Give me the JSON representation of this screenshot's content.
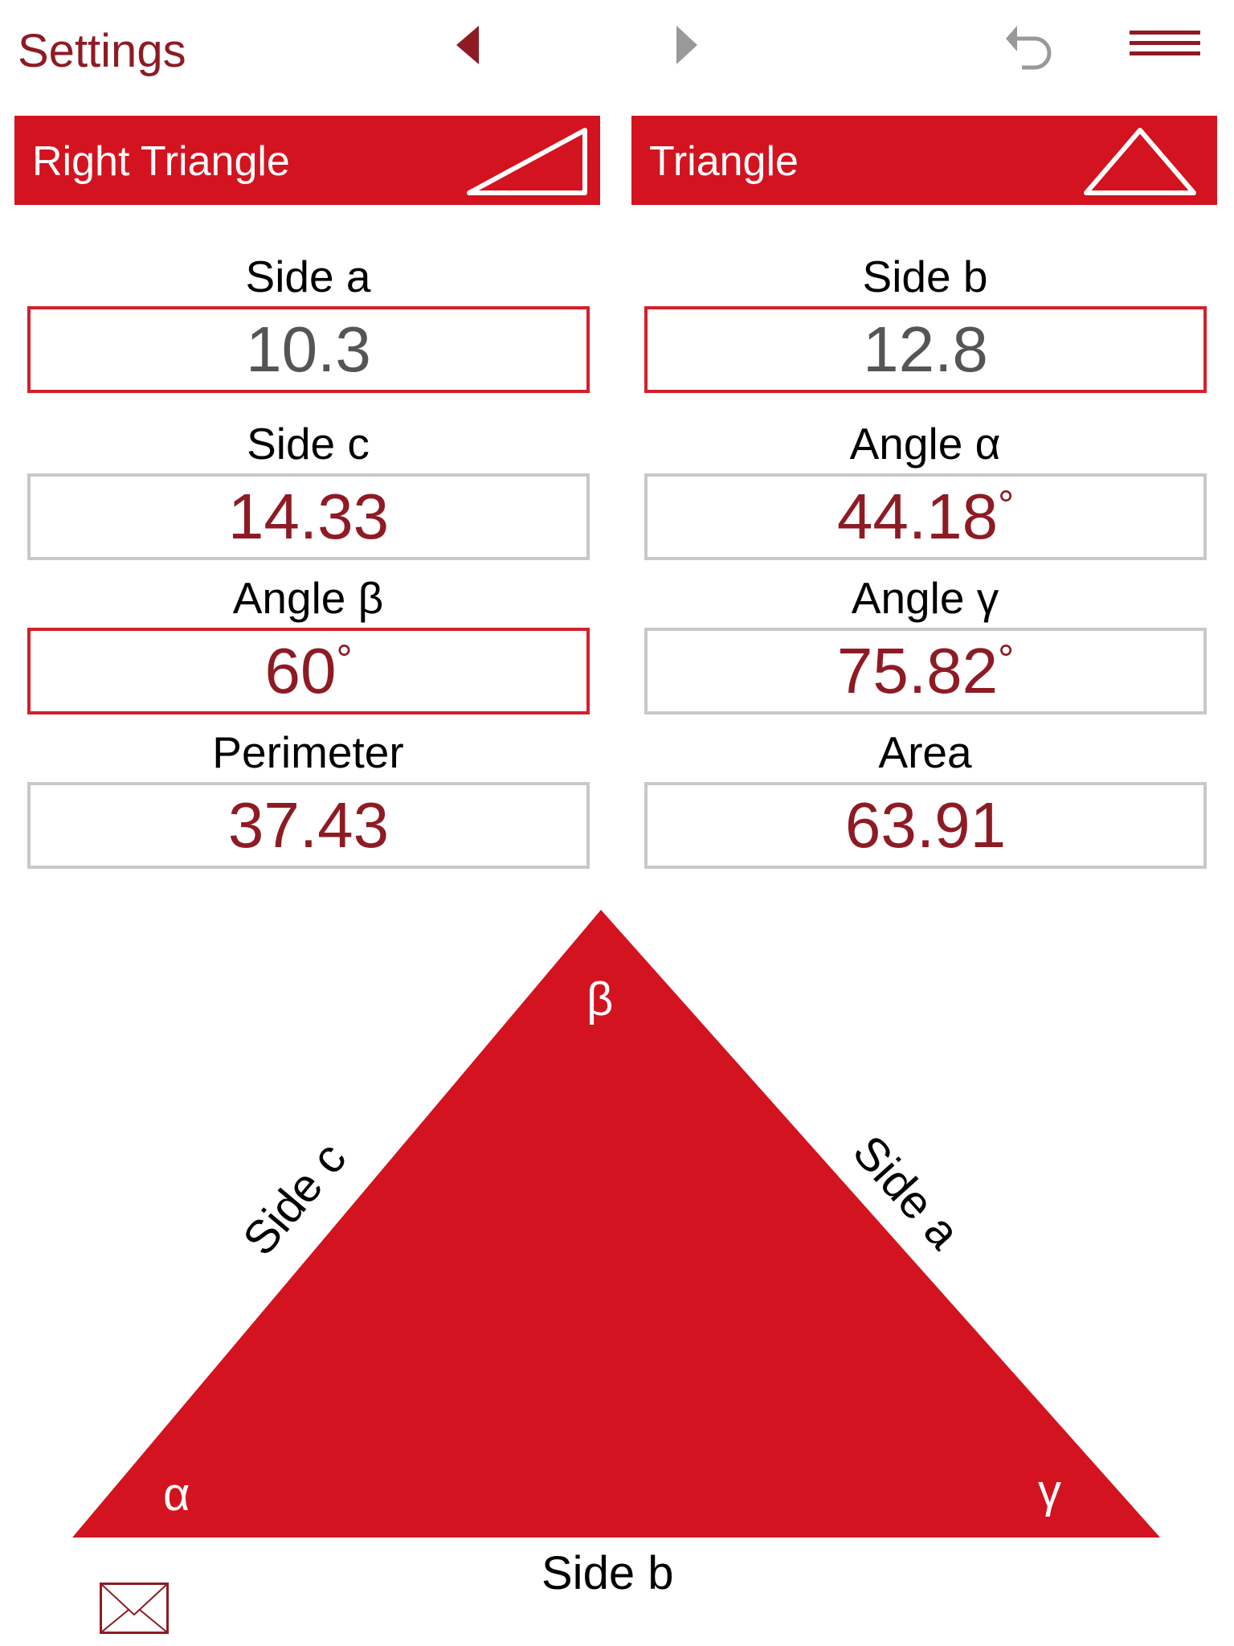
{
  "header": {
    "title": "Settings",
    "icons": [
      "prev-arrow-icon",
      "next-arrow-icon",
      "undo-icon",
      "menu-icon"
    ]
  },
  "modes": [
    {
      "label": "Right Triangle",
      "icon": "right-triangle-icon"
    },
    {
      "label": "Triangle",
      "icon": "triangle-icon"
    }
  ],
  "fields": [
    {
      "label": "Side a",
      "value": "10.3"
    },
    {
      "label": "Side b",
      "value": "12.8"
    },
    {
      "label": "Side c",
      "value": "14.33"
    },
    {
      "label": "Angle α",
      "value": "44.18",
      "unit": "°"
    },
    {
      "label": "Angle β",
      "value": "60",
      "unit": "°"
    },
    {
      "label": "Angle γ",
      "value": "75.82",
      "unit": "°"
    },
    {
      "label": "Perimeter",
      "value": "37.43"
    },
    {
      "label": "Area",
      "value": "63.91"
    }
  ],
  "diagram": {
    "beta": "β",
    "alpha": "α",
    "gamma": "γ",
    "side_a": "Side a",
    "side_b": "Side b",
    "side_c": "Side c",
    "fill": "#D3131F"
  },
  "colors": {
    "accent": "#D3131F",
    "text_dark_red": "#8E1B24"
  },
  "footer": {
    "icon": "email-icon"
  }
}
